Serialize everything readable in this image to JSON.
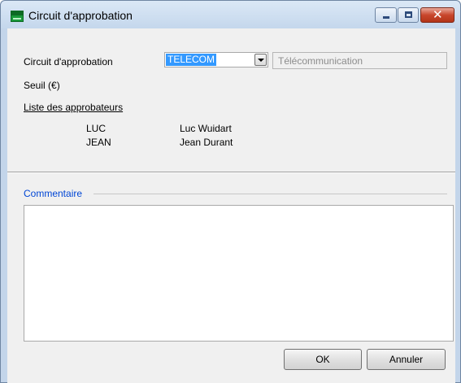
{
  "window": {
    "title": "Circuit d'approbation",
    "controls": [
      "minimize-icon",
      "maximize-icon",
      "close-icon"
    ],
    "close_glyph": "✕"
  },
  "form": {
    "circuit_label": "Circuit d'approbation",
    "circuit_value": "TELECOM",
    "circuit_description": "Télécommunication",
    "seuil_label": "Seuil (€)",
    "approvers_label": "Liste des approbateurs",
    "approvers": [
      {
        "code": "LUC",
        "name": "Luc  Wuidart"
      },
      {
        "code": "JEAN",
        "name": "Jean  Durant"
      }
    ]
  },
  "comment": {
    "legend": "Commentaire",
    "value": ""
  },
  "buttons": {
    "ok": "OK",
    "cancel": "Annuler"
  },
  "colors": {
    "selection": "#3399ff",
    "legend": "#0046d5",
    "close_button": "#c8462c"
  }
}
